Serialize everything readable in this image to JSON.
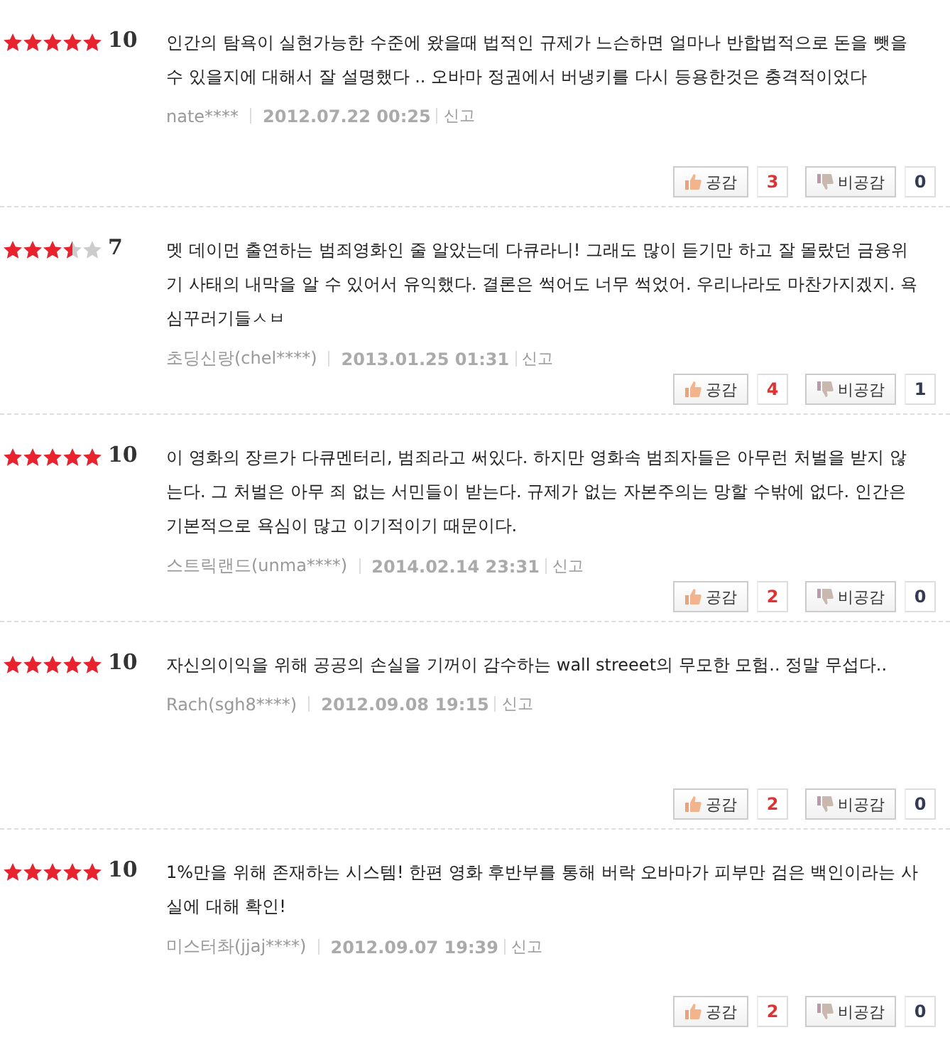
{
  "reviews": [
    {
      "stars": 5,
      "score": "10",
      "text": "인간의 탐욕이 실현가능한 수준에 왔을때 법적인 규제가 느슨하면 얼마나 반합법적으로 돈을 뺏을수 있을지에 대해서 잘 설명했다 .. 오바마 정권에서 버냉키를 다시 등용한것은 충격적이었다",
      "author": "nate****",
      "date": "2012.07.22 00:25",
      "report": "신고",
      "agree_label": "공감",
      "agree_count": "3",
      "disagree_label": "비공감",
      "disagree_count": "0"
    },
    {
      "stars": 3.5,
      "score": "7",
      "text": "멧 데이먼 출연하는 범죄영화인 줄 알았는데 다큐라니! 그래도 많이 듣기만 하고 잘 몰랐던 금융위기 사태의 내막을 알 수 있어서 유익했다. 결론은 썩어도 너무 썩었어. 우리나라도 마찬가지겠지. 욕심꾸러기들ㅅㅂ",
      "author": "초딩신랑(chel****)",
      "date": "2013.01.25 01:31",
      "report": "신고",
      "agree_label": "공감",
      "agree_count": "4",
      "disagree_label": "비공감",
      "disagree_count": "1"
    },
    {
      "stars": 5,
      "score": "10",
      "text": "이 영화의 장르가 다큐멘터리, 범죄라고 써있다. 하지만 영화속 범죄자들은 아무런 처벌을 받지 않는다. 그 처벌은 아무 죄 없는 서민들이 받는다. 규제가 없는 자본주의는 망할 수밖에 없다. 인간은 기본적으로 욕심이 많고 이기적이기 때문이다.",
      "author": "스트릭랜드(unma****)",
      "date": "2014.02.14 23:31",
      "report": "신고",
      "agree_label": "공감",
      "agree_count": "2",
      "disagree_label": "비공감",
      "disagree_count": "0"
    },
    {
      "stars": 5,
      "score": "10",
      "text": "자신의이익을 위해 공공의 손실을 기꺼이 감수하는 wall streeet의 무모한 모험.. 정말 무섭다..",
      "author": "Rach(sgh8****)",
      "date": "2012.09.08 19:15",
      "report": "신고",
      "agree_label": "공감",
      "agree_count": "2",
      "disagree_label": "비공감",
      "disagree_count": "0"
    },
    {
      "stars": 5,
      "score": "10",
      "text": "1%만을 위해 존재하는 시스템! 한편 영화 후반부를 통해 버락 오바마가 피부만 검은 백인이라는 사실에 대해 확인!",
      "author": "미스터촤(jjaj****)",
      "date": "2012.09.07 19:39",
      "report": "신고",
      "agree_label": "공감",
      "agree_count": "2",
      "disagree_label": "비공감",
      "disagree_count": "0"
    }
  ]
}
